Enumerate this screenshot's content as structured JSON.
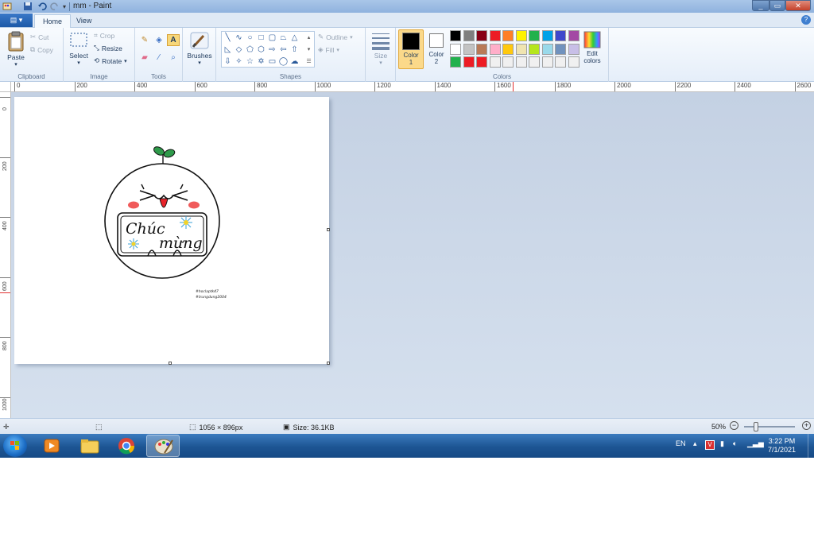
{
  "window": {
    "title": "mm - Paint"
  },
  "menubar": {
    "file_label": "▤ ▾",
    "tabs": [
      {
        "label": "Home"
      },
      {
        "label": "View"
      }
    ]
  },
  "ribbon": {
    "clipboard": {
      "label": "Clipboard",
      "paste": "Paste",
      "cut": "Cut",
      "copy": "Copy"
    },
    "image": {
      "label": "Image",
      "select": "Select",
      "crop": "Crop",
      "resize": "Resize",
      "rotate": "Rotate"
    },
    "tools": {
      "label": "Tools"
    },
    "brushes": {
      "label": "Brushes"
    },
    "shapes": {
      "label": "Shapes",
      "outline": "Outline",
      "fill": "Fill"
    },
    "size": {
      "label": "Size"
    },
    "colors": {
      "label": "Colors",
      "color1": "Color\n1",
      "color2": "Color\n2",
      "edit": "Edit\ncolors",
      "color1_value": "#000000",
      "color2_value": "#ffffff",
      "palette": [
        "#000000",
        "#7f7f7f",
        "#880015",
        "#ed1c24",
        "#ff7f27",
        "#fff200",
        "#22b14c",
        "#00a2e8",
        "#3f48cc",
        "#a349a4",
        "#ffffff",
        "#c3c3c3",
        "#b97a57",
        "#ffaec9",
        "#ffc90e",
        "#efe4b0",
        "#b5e61d",
        "#99d9ea",
        "#7092be",
        "#c8bfe7",
        "#22b14c",
        "#ed1c24",
        "#ed1c24",
        "#f0f0f0",
        "#f0f0f0",
        "#f0f0f0",
        "#f0f0f0",
        "#f0f0f0",
        "#f0f0f0",
        "#f0f0f0"
      ]
    }
  },
  "ruler": {
    "h_ticks": [
      "0",
      "200",
      "400",
      "600",
      "800",
      "1000",
      "1200",
      "1400",
      "1600",
      "1800",
      "2000",
      "2200",
      "2400",
      "2600"
    ],
    "v_ticks": [
      "0",
      "200",
      "400",
      "600",
      "800",
      "1000"
    ]
  },
  "artwork": {
    "greeting_line1": "Chúc",
    "greeting_line2": "mừng",
    "credit_line1": "#hoclaptk47",
    "credit_line2": "#trungdung2004"
  },
  "statusbar": {
    "dimensions": "1056 × 896px",
    "size": "Size: 36.1KB",
    "zoom": "50%",
    "zoom_value": 0.5
  },
  "taskbar": {
    "language": "EN",
    "time": "3:22 PM",
    "date": "7/1/2021"
  }
}
